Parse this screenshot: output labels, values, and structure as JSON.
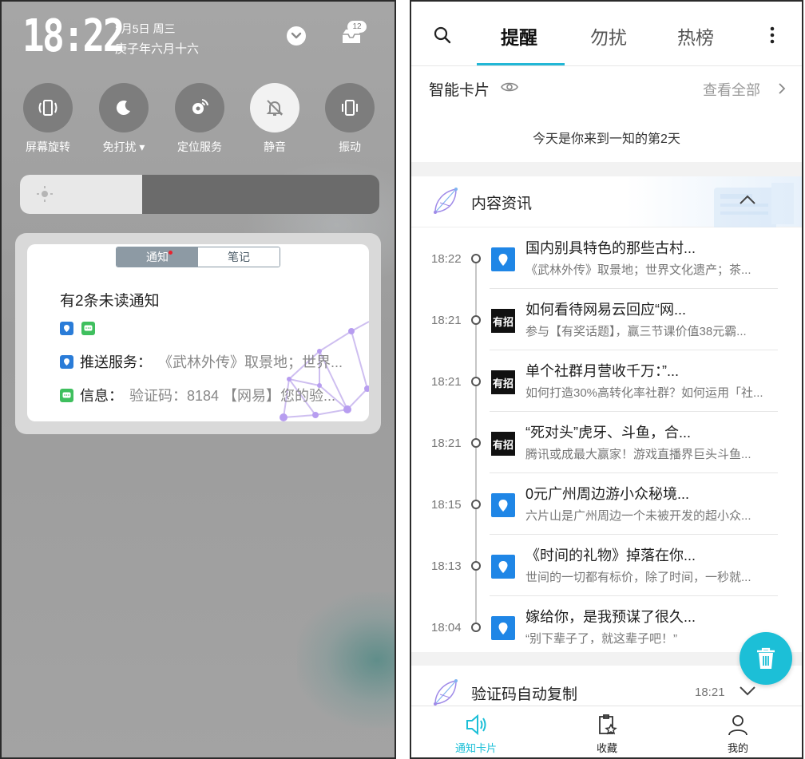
{
  "status": {
    "time": "18:22",
    "date_line": "8月5日 周三",
    "lunar_line": "庚子年六月十六",
    "inbox_badge": "12"
  },
  "quick_settings": [
    {
      "label": "屏幕旋转",
      "icon": "rotate-icon",
      "active": false
    },
    {
      "label": "免打扰 ▾",
      "icon": "moon-icon",
      "active": false
    },
    {
      "label": "定位服务",
      "icon": "location-icon",
      "active": false
    },
    {
      "label": "静音",
      "icon": "mute-bell-icon",
      "active": true
    },
    {
      "label": "振动",
      "icon": "vibrate-icon",
      "active": false
    }
  ],
  "brightness": {
    "level": 0.34
  },
  "notification_panel": {
    "tabs": [
      "通知",
      "笔记"
    ],
    "unread_text": "有2条未读通知",
    "items": [
      {
        "source": "推送服务：",
        "text": "《武林外传》取景地；世界...",
        "icon_color": "#2a7cd8"
      },
      {
        "source": "信息：",
        "text": "验证码：8184 【网易】您的验...",
        "icon_color": "#3fbf5e"
      }
    ]
  },
  "right": {
    "tabs": [
      "提醒",
      "勿扰",
      "热榜"
    ],
    "active_tab": "提醒",
    "accent": "#22b7d6",
    "smart_card": {
      "title": "智能卡片",
      "see_all": "查看全部",
      "day_text": "今天是你来到一知的第2天"
    },
    "content_section": {
      "title": "内容资讯"
    },
    "items": [
      {
        "time": "18:22",
        "title": "国内别具特色的那些古村...",
        "sub": "《武林外传》取景地；世界文化遗产；茶...",
        "icon": "blue"
      },
      {
        "time": "18:21",
        "title": "如何看待网易云回应“网...",
        "sub": "参与【有奖话题】，赢三节课价值38元霸...",
        "icon": "dark",
        "icon_text": "有招"
      },
      {
        "time": "18:21",
        "title": "单个社群月营收千万：”...",
        "sub": "如何打造30%高转化率社群？如何运用「社...",
        "icon": "dark",
        "icon_text": "有招"
      },
      {
        "time": "18:21",
        "title": "“死对头”虎牙、斗鱼，合...",
        "sub": "腾讯或成最大赢家！游戏直播界巨头斗鱼...",
        "icon": "dark",
        "icon_text": "有招"
      },
      {
        "time": "18:15",
        "title": "0元广州周边游小众秘境...",
        "sub": "六片山是广州周边一个未被开发的超小众...",
        "icon": "blue"
      },
      {
        "time": "18:13",
        "title": "《时间的礼物》掉落在你...",
        "sub": "世间的一切都有标价，除了时间，一秒就...",
        "icon": "blue"
      },
      {
        "time": "18:04",
        "title": "嫁给你，是我预谋了很久...",
        "sub": "“别下辈子了，就这辈子吧！”",
        "icon": "blue"
      }
    ],
    "verify_section": {
      "title": "验证码自动复制",
      "time": "18:21"
    },
    "bottom_nav": [
      {
        "label": "通知卡片",
        "icon": "notification-card-icon",
        "active": true
      },
      {
        "label": "收藏",
        "icon": "favorites-icon",
        "active": false
      },
      {
        "label": "我的",
        "icon": "profile-icon",
        "active": false
      }
    ]
  }
}
